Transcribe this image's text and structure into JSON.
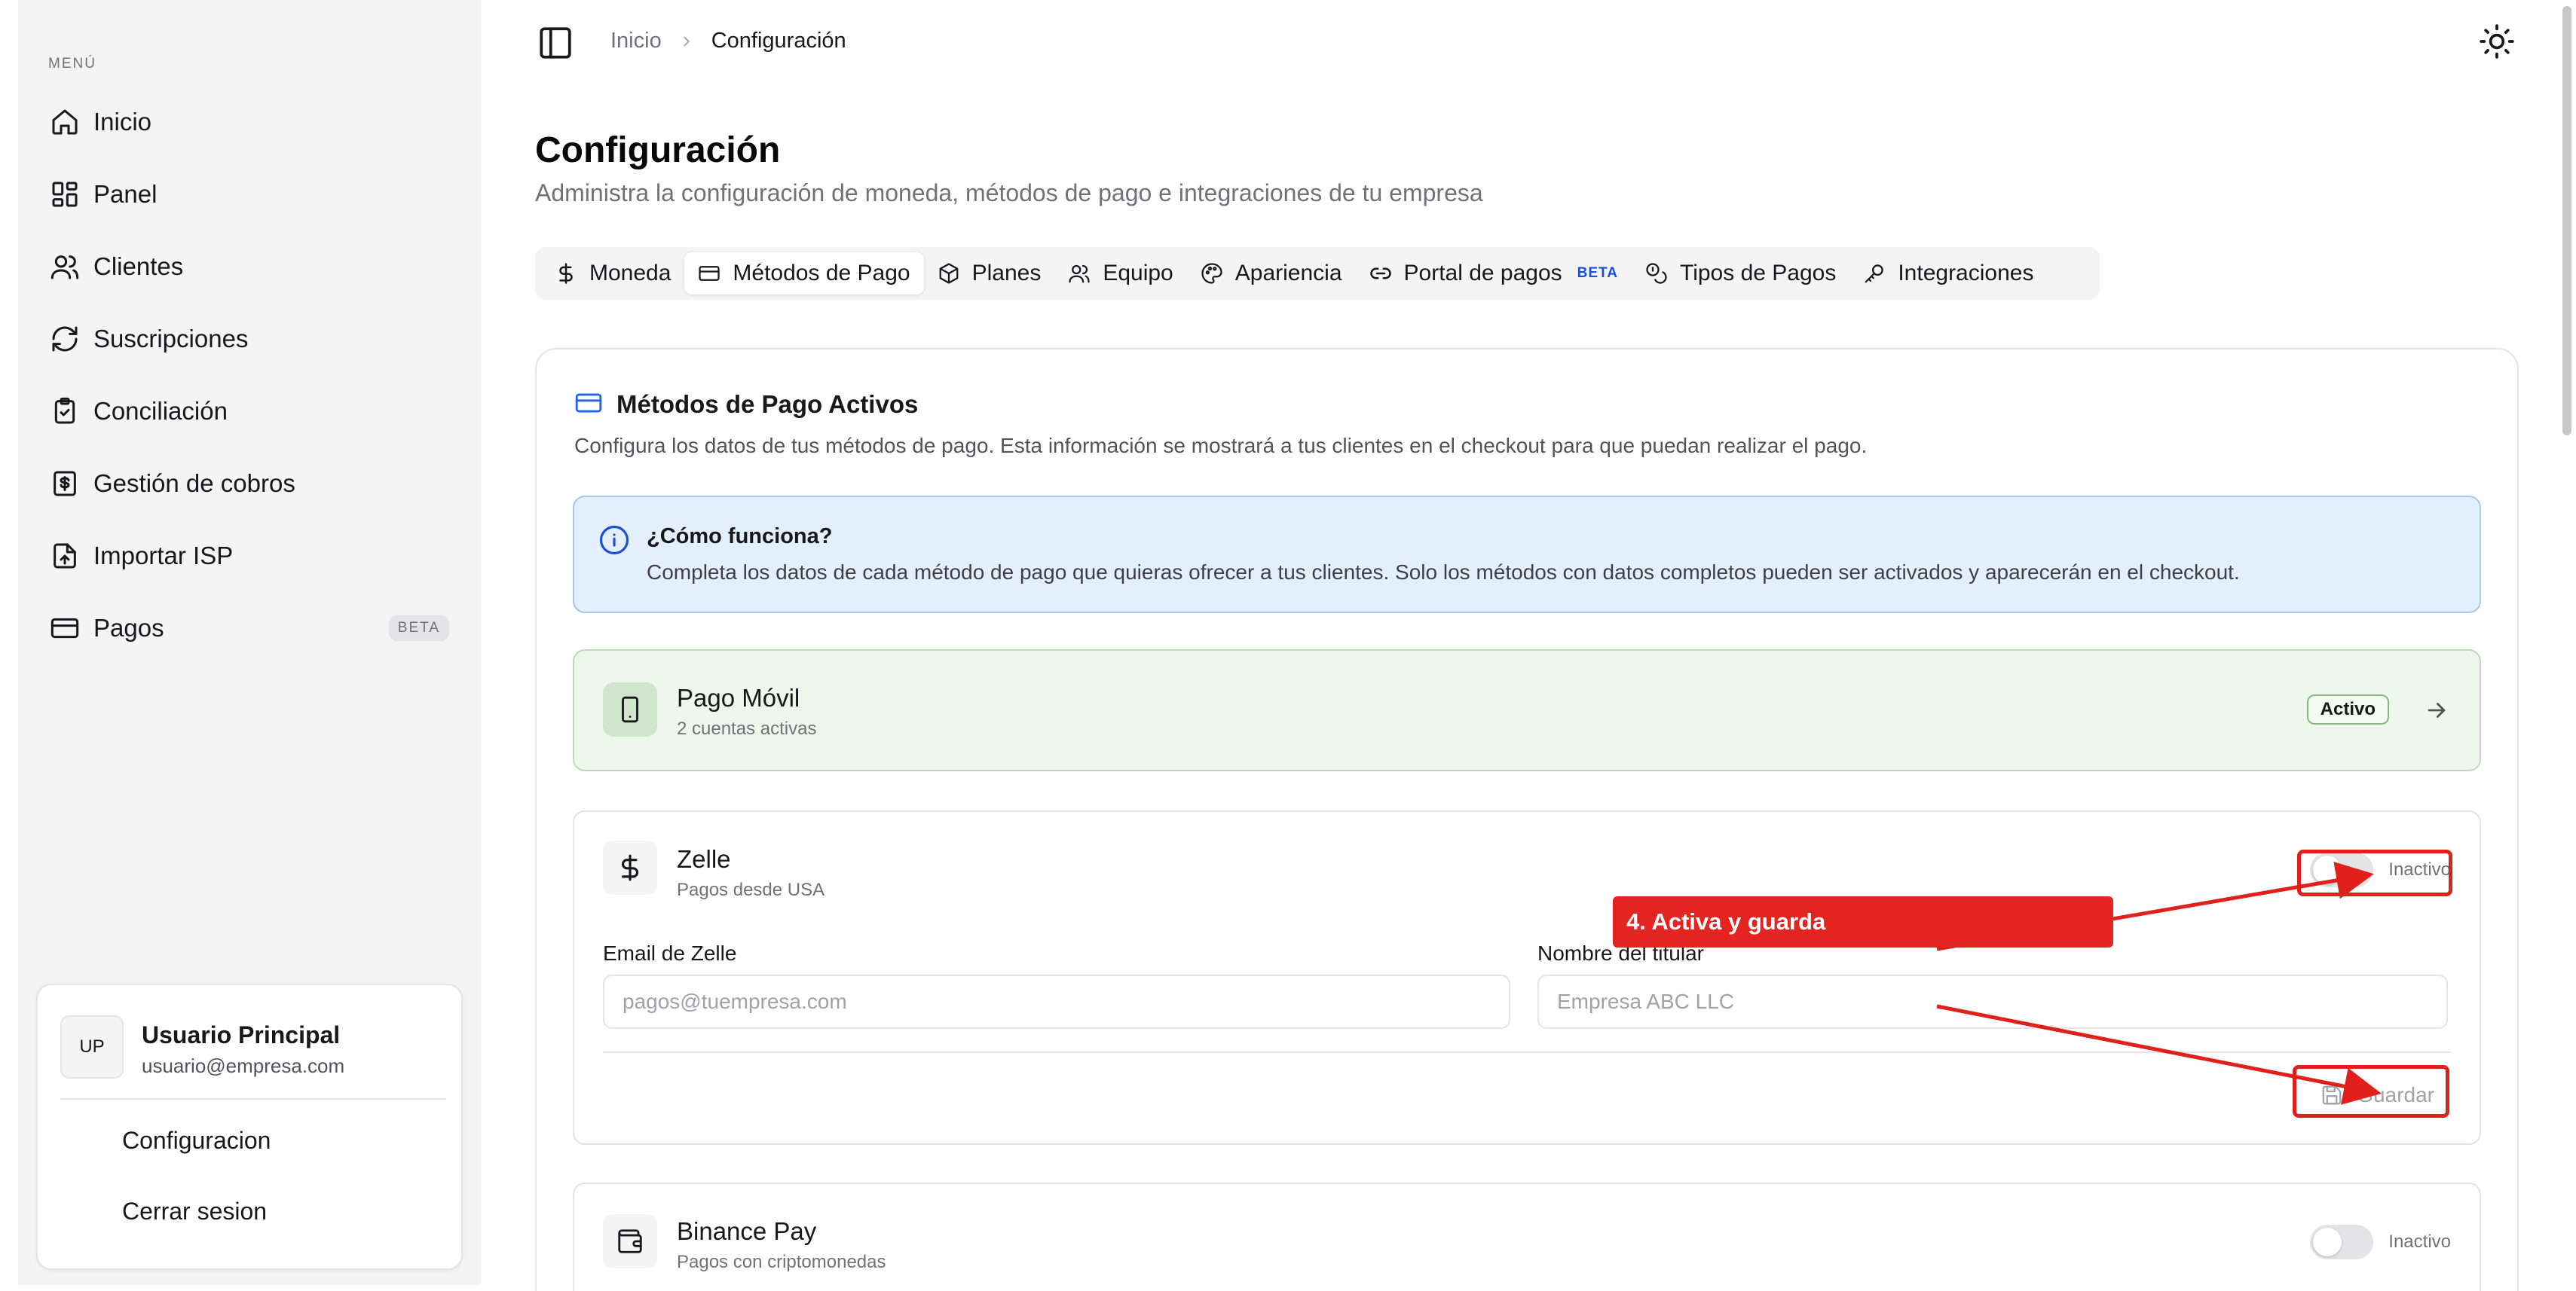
{
  "sidebar": {
    "menu_label": "MENÚ",
    "items": [
      {
        "label": "Inicio",
        "icon": "home-icon"
      },
      {
        "label": "Panel",
        "icon": "dashboard-icon"
      },
      {
        "label": "Clientes",
        "icon": "users-icon"
      },
      {
        "label": "Suscripciones",
        "icon": "refresh-icon"
      },
      {
        "label": "Conciliación",
        "icon": "clipboard-check-icon"
      },
      {
        "label": "Gestión de cobros",
        "icon": "dollar-file-icon"
      },
      {
        "label": "Importar ISP",
        "icon": "file-upload-icon"
      },
      {
        "label": "Pagos",
        "icon": "credit-card-icon",
        "badge": "BETA"
      }
    ],
    "user": {
      "initials": "UP",
      "name": "Usuario Principal",
      "email": "usuario@empresa.com",
      "links": [
        "Configuracion",
        "Cerrar sesion"
      ]
    }
  },
  "header": {
    "breadcrumb": {
      "home": "Inicio",
      "current": "Configuración"
    }
  },
  "page": {
    "title": "Configuración",
    "subtitle": "Administra la configuración de moneda, métodos de pago e integraciones de tu empresa"
  },
  "tabs": [
    {
      "label": "Moneda",
      "icon": "dollar-icon"
    },
    {
      "label": "Métodos de Pago",
      "icon": "credit-card-icon",
      "active": true
    },
    {
      "label": "Planes",
      "icon": "package-icon"
    },
    {
      "label": "Equipo",
      "icon": "users-icon"
    },
    {
      "label": "Apariencia",
      "icon": "palette-icon"
    },
    {
      "label": "Portal de pagos",
      "icon": "link-icon",
      "badge": "BETA"
    },
    {
      "label": "Tipos de Pagos",
      "icon": "coins-icon"
    },
    {
      "label": "Integraciones",
      "icon": "key-icon"
    }
  ],
  "card": {
    "title": "Métodos de Pago Activos",
    "description": "Configura los datos de tus métodos de pago. Esta información se mostrará a tus clientes en el checkout para que puedan realizar el pago.",
    "info": {
      "title": "¿Cómo funciona?",
      "text": "Completa los datos de cada método de pago que quieras ofrecer a tus clientes. Solo los métodos con datos completos pueden ser activados y aparecerán en el checkout."
    },
    "methods": {
      "pago_movil": {
        "name": "Pago Móvil",
        "sub": "2 cuentas activas",
        "status": "Activo"
      },
      "zelle": {
        "name": "Zelle",
        "sub": "Pagos desde USA",
        "status": "Inactivo",
        "email_label": "Email de Zelle",
        "email_placeholder": "pagos@tuempresa.com",
        "holder_label": "Nombre del titular",
        "holder_placeholder": "Empresa ABC LLC",
        "save_label": "Guardar"
      },
      "binance": {
        "name": "Binance Pay",
        "sub": "Pagos con criptomonedas",
        "status": "Inactivo"
      }
    }
  },
  "annotation": {
    "label": "4. Activa y guarda",
    "color": "#e32421"
  },
  "colors": {
    "accent": "#2563eb",
    "active_green": "#eef7ec",
    "info_blue": "#e3effd"
  }
}
